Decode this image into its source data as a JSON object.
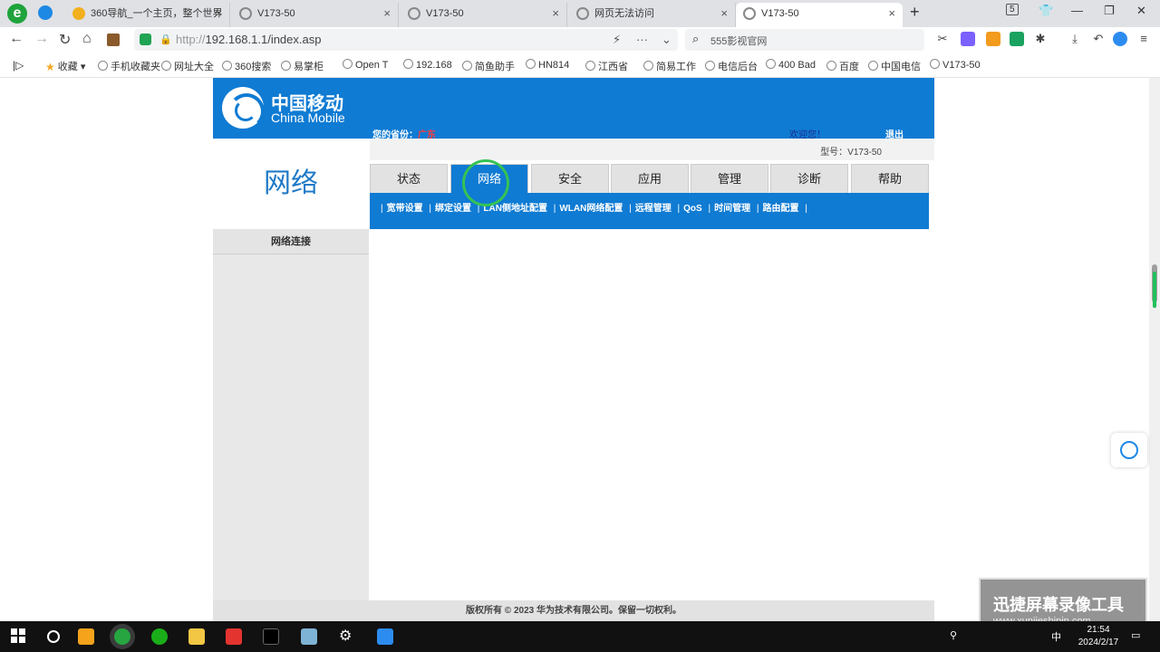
{
  "tabs": [
    {
      "title": "360导航_一个主页，整个世界"
    },
    {
      "title": "V173-50"
    },
    {
      "title": "V173-50"
    },
    {
      "title": "网页无法访问"
    },
    {
      "title": "V173-50"
    }
  ],
  "window": {
    "minimize": "—",
    "maximize": "❐",
    "close": "✕",
    "badge": "5"
  },
  "address": {
    "scheme": "http://",
    "rest": "192.168.1.1/index.asp"
  },
  "search": {
    "placeholder": "555影视官网"
  },
  "bookmarks": [
    {
      "label": "收藏"
    },
    {
      "label": "手机收藏夹"
    },
    {
      "label": "网址大全"
    },
    {
      "label": "360搜索"
    },
    {
      "label": "易掌柜"
    },
    {
      "label": "Open T"
    },
    {
      "label": "192.168"
    },
    {
      "label": "简鱼助手"
    },
    {
      "label": "HN814"
    },
    {
      "label": "江西省"
    },
    {
      "label": "简易工作"
    },
    {
      "label": "电信后台"
    },
    {
      "label": "400 Bad"
    },
    {
      "label": "百度"
    },
    {
      "label": "中国电信"
    },
    {
      "label": "V173-50"
    }
  ],
  "router": {
    "brand_cn": "中国移动",
    "brand_en": "China Mobile",
    "province_label": "您的省份：",
    "province_value": "广东",
    "welcome": "欢迎您！",
    "logout": "退出",
    "model": "型号：V173-50",
    "section_title": "网络",
    "left_items": [
      "网络连接"
    ],
    "menu": [
      {
        "label": "状态",
        "active": false
      },
      {
        "label": "网络",
        "active": true
      },
      {
        "label": "安全",
        "active": false
      },
      {
        "label": "应用",
        "active": false
      },
      {
        "label": "管理",
        "active": false
      },
      {
        "label": "诊断",
        "active": false
      },
      {
        "label": "帮助",
        "active": false
      }
    ],
    "submenu": [
      "宽带设置",
      "绑定设置",
      "LAN侧地址配置",
      "WLAN网络配置",
      "远程管理",
      "QoS",
      "时间管理",
      "路由配置"
    ],
    "footer": "版权所有 © 2023 华为技术有限公司。保留一切权利。"
  },
  "watermark": {
    "title": "迅捷屏幕录像工具",
    "url": "www.xunjieshipin.com"
  },
  "taskbar": {
    "time": "21:54",
    "date": "2024/2/17",
    "ime": "中"
  }
}
